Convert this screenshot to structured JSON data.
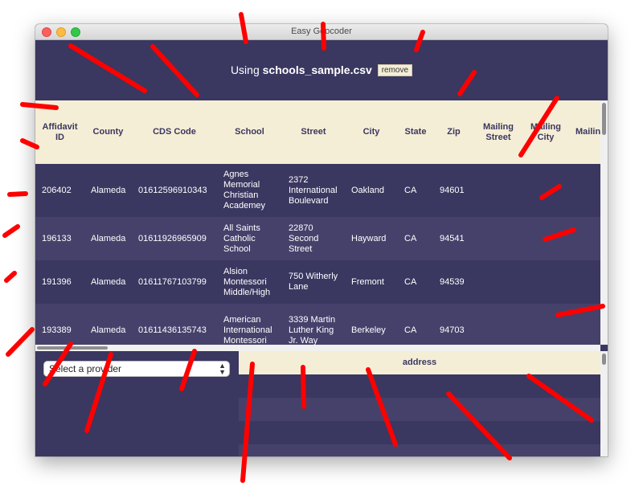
{
  "window": {
    "title": "Easy Geocoder"
  },
  "header": {
    "using_prefix": "Using",
    "filename": "schools_sample.csv",
    "remove_label": "remove"
  },
  "table": {
    "columns": [
      "Affidavit ID",
      "County",
      "CDS Code",
      "School",
      "Street",
      "City",
      "State",
      "Zip",
      "Mailing Street",
      "Mailing City",
      "Mailing State"
    ],
    "rows": [
      [
        "206402",
        "Alameda",
        "01612596910343",
        "Agnes Memorial Christian Academey",
        "2372 International Boulevard",
        "Oakland",
        "CA",
        "94601",
        "",
        "",
        ""
      ],
      [
        "196133",
        "Alameda",
        "01611926965909",
        "All Saints Catholic School",
        "22870 Second Street",
        "Hayward",
        "CA",
        "94541",
        "",
        "",
        ""
      ],
      [
        "191396",
        "Alameda",
        "01611767103799",
        "Alsion Montessori Middle/High",
        "750 Witherly Lane",
        "Fremont",
        "CA",
        "94539",
        "",
        "",
        ""
      ],
      [
        "193389",
        "Alameda",
        "01611436135743",
        "American International Montessori",
        "3339 Martin Luther King Jr. Way",
        "Berkeley",
        "CA",
        "94703",
        "",
        "",
        ""
      ]
    ]
  },
  "provider": {
    "placeholder": "Select a provider",
    "arrow_icon": "up-down-arrows-icon"
  },
  "results": {
    "column": "address"
  },
  "colors": {
    "background": "#3a3760",
    "row_alt": "#45416b",
    "header": "#f5eed6",
    "annotation": "#ff0000"
  }
}
